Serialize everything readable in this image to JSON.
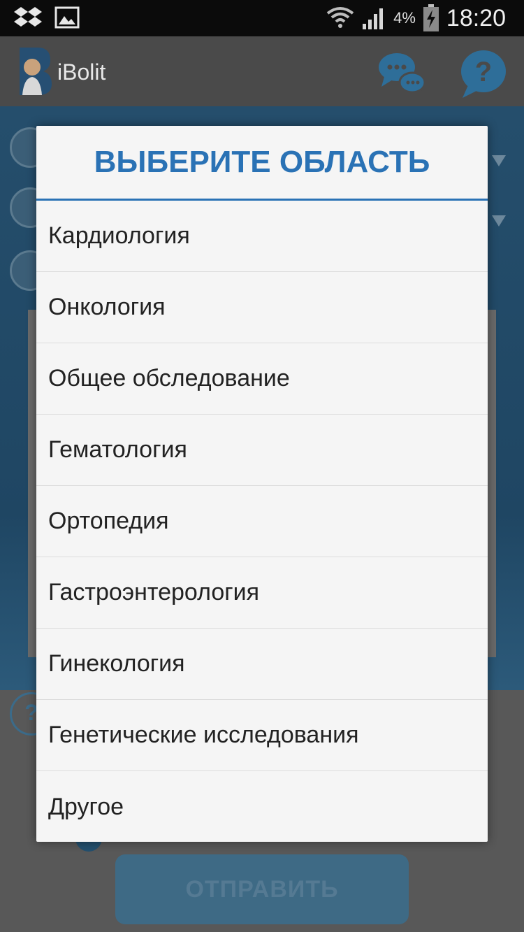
{
  "status_bar": {
    "battery_percent": "4%",
    "time": "18:20",
    "icons": [
      "dropbox-icon",
      "image-icon",
      "wifi-icon",
      "signal-icon",
      "battery-charging-icon"
    ]
  },
  "app_bar": {
    "title": "iBolit",
    "icons": [
      "logo-icon",
      "chat-icon",
      "help-icon"
    ]
  },
  "background": {
    "help_symbol": "?",
    "send_button_label": "ОТПРАВИТЬ"
  },
  "dialog": {
    "title": "ВЫБЕРИТЕ ОБЛАСТЬ",
    "options": [
      "Кардиология",
      "Онкология",
      "Общее обследование",
      "Гематология",
      "Ортопедия",
      "Гастроэнтерология",
      "Гинекология",
      "Генетические исследования",
      "Другое"
    ]
  },
  "colors": {
    "accent": "#2a72b5",
    "dialog_bg": "#f5f5f5",
    "app_bar_dimmed": "#4a4a4a"
  }
}
